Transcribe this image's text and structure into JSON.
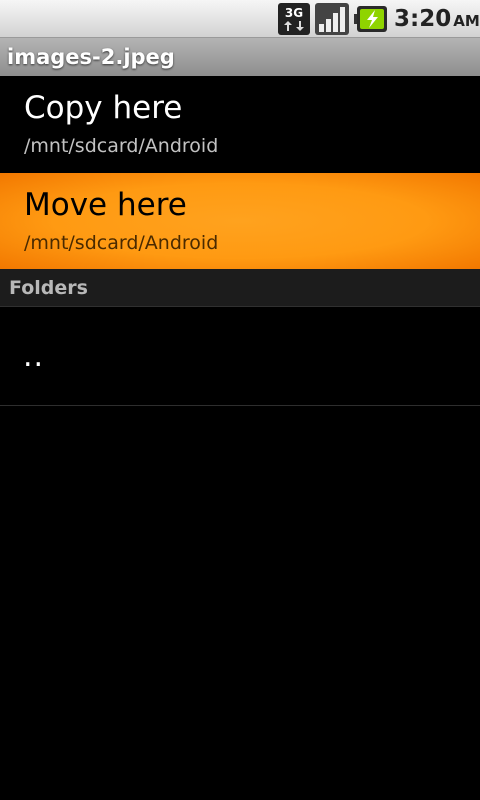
{
  "status_bar": {
    "network_label": "3G",
    "time": "3:20",
    "ampm": "AM",
    "icons": [
      "3g-data-icon",
      "signal-strength-icon",
      "battery-charging-icon"
    ]
  },
  "title_bar": {
    "title": "images-2.jpeg"
  },
  "actions": [
    {
      "label": "Copy here",
      "path": "/mnt/sdcard/Android"
    },
    {
      "label": "Move here",
      "path": "/mnt/sdcard/Android"
    }
  ],
  "folders": {
    "header": "Folders",
    "items": [
      {
        "name": ".."
      }
    ]
  },
  "colors": {
    "highlight": "#ff9a12",
    "background": "#000000",
    "title_bar": "#9e9e9e"
  }
}
